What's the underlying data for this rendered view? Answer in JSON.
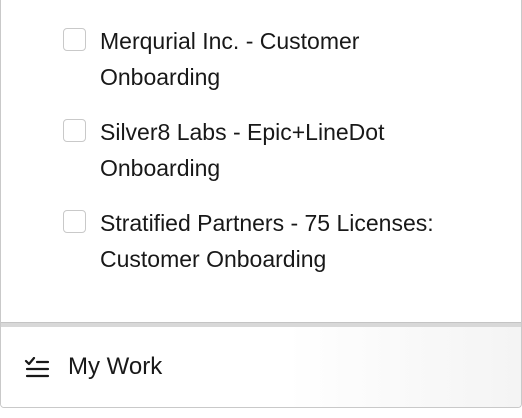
{
  "tasks": [
    {
      "label": "Merqurial Inc. - Customer Onboarding",
      "checked": false
    },
    {
      "label": "Silver8 Labs - Epic+LineDot Onboarding",
      "checked": false
    },
    {
      "label": "Stratified Partners - 75 Licenses: Customer Onboarding",
      "checked": false
    }
  ],
  "footer": {
    "label": "My Work",
    "icon": "task-list-icon"
  }
}
